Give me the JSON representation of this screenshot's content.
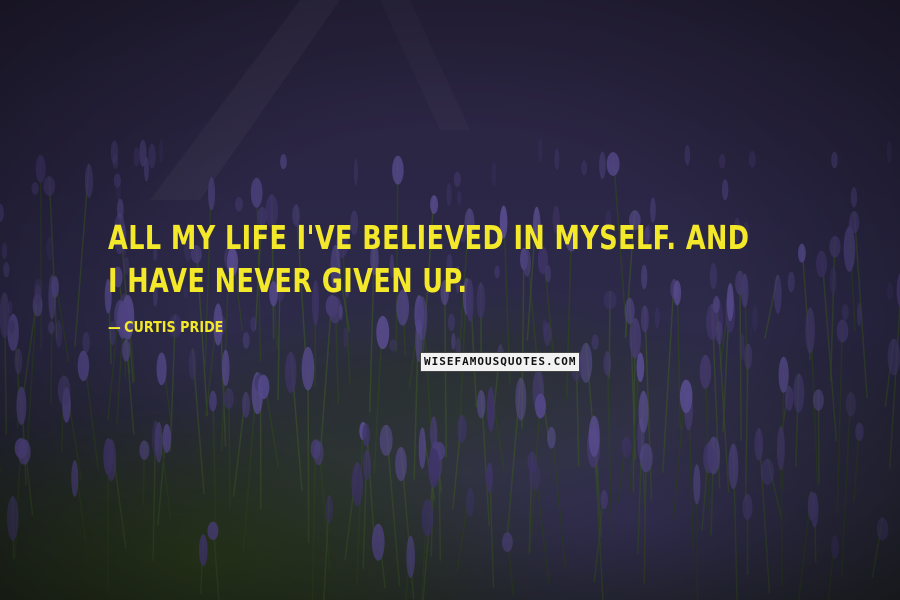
{
  "quote": {
    "text": "All my life I've believed in myself. And I have never given up.",
    "author_dash": "—",
    "author": "Curtis Pride"
  },
  "watermark": {
    "text": "WISEFAMOUSQUOTES.COM"
  },
  "colors": {
    "quote_text": "#f4e82a",
    "background": "#2a2440",
    "lavender": "#4a3f7a",
    "foliage": "#2e401c"
  }
}
